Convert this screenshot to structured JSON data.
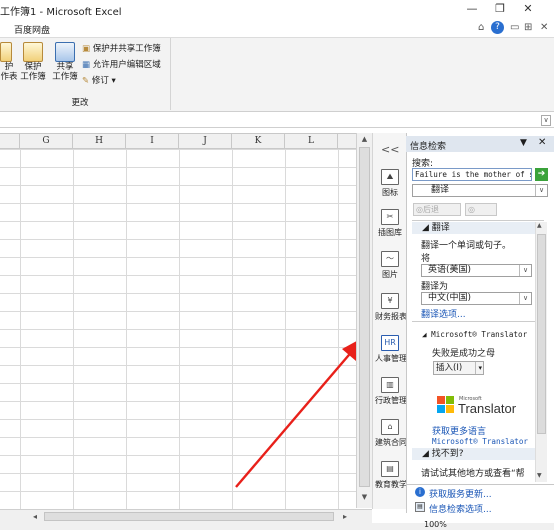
{
  "window": {
    "title": "工作簿1 - Microsoft Excel",
    "controls": [
      "—",
      "❐",
      "✕"
    ]
  },
  "tabs": {
    "baidu": "百度网盘",
    "help_icons": [
      "⌂",
      "?",
      "▭",
      "⊞",
      "✕"
    ]
  },
  "ribbon": {
    "btn_protect_sheet": "保护\n工作表",
    "btn_protect_sheet_l1": "护",
    "btn_protect_sheet_l2": "作表",
    "btn_protect_workbook_l1": "保护",
    "btn_protect_workbook_l2": "工作簿",
    "btn_share_l1": "共享",
    "btn_share_l2": "工作簿",
    "protect_share": "保护并共享工作簿",
    "allow_edit": "允许用户编辑区域",
    "track": "修订 ▾",
    "group_label": "更改"
  },
  "grid": {
    "columns": [
      "G",
      "H",
      "I",
      "J",
      "K",
      "L"
    ]
  },
  "tools": {
    "items": [
      {
        "label": "图标",
        "icon": "⛰"
      },
      {
        "label": "插图库",
        "icon": "✂"
      },
      {
        "label": "图片",
        "icon": "〜"
      },
      {
        "label": "财务报表",
        "icon": "¥"
      },
      {
        "label": "人事管理",
        "icon": "HR"
      },
      {
        "label": "行政管理",
        "icon": "▥"
      },
      {
        "label": "建筑合同",
        "icon": "⌂"
      },
      {
        "label": "教育教学",
        "icon": "▤"
      }
    ],
    "collapse": "<<"
  },
  "research": {
    "title": "信息检索",
    "search_label": "搜索:",
    "search_value": "Failure is the mother of s",
    "service": "翻译",
    "nav_back": "◎后退",
    "nav_forward": "◎",
    "sec_translate": "◢ 翻译",
    "translate_prompt": "翻译一个单词或句子。",
    "from_label": "将",
    "from_value": "英语(美国)",
    "to_label": "翻译为",
    "to_value": "中文(中国)",
    "options_link": "翻译选项...",
    "ms_header": "◢ Microsoft® Translator",
    "result": "失败是成功之母",
    "insert": "插入(I)",
    "logo_small": "Microsoft",
    "logo": "Translator",
    "more_langs": "获取更多语言",
    "ms_link": "Microsoft® Translator",
    "notfound": "◢ 找不到?",
    "try_other": "请试试其他地方或查看“帮",
    "update": "获取服务更新...",
    "search_options": "信息检索选项..."
  },
  "statusbar": {
    "zoom": "100%"
  }
}
